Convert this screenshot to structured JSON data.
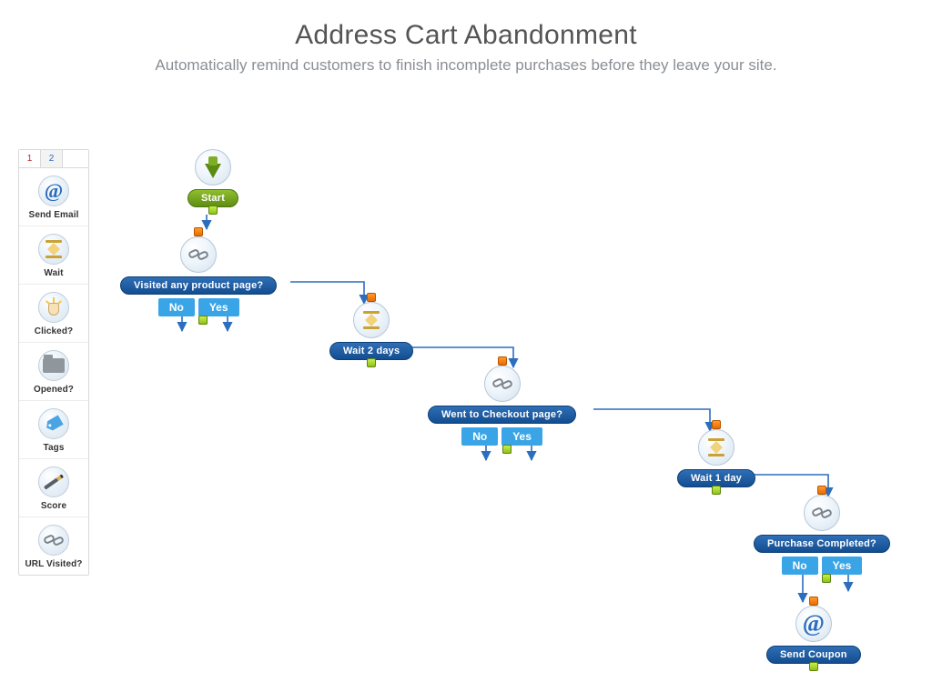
{
  "header": {
    "title": "Address Cart Abandonment",
    "subtitle": "Automatically remind customers to finish incomplete purchases before they leave your site."
  },
  "palette": {
    "tabs": [
      "1",
      "2"
    ],
    "active_tab_index": 0,
    "items": [
      {
        "id": "send-email",
        "label": "Send Email",
        "icon": "at"
      },
      {
        "id": "wait",
        "label": "Wait",
        "icon": "hourglass"
      },
      {
        "id": "clicked",
        "label": "Clicked?",
        "icon": "click"
      },
      {
        "id": "opened",
        "label": "Opened?",
        "icon": "folder"
      },
      {
        "id": "tags",
        "label": "Tags",
        "icon": "tag"
      },
      {
        "id": "score",
        "label": "Score",
        "icon": "pencil"
      },
      {
        "id": "url-visited",
        "label": "URL Visited?",
        "icon": "chain"
      }
    ]
  },
  "flow": {
    "start_label": "Start",
    "yes_label": "Yes",
    "no_label": "No",
    "nodes": {
      "visited_product": {
        "label": "Visited any product page?"
      },
      "wait_2_days": {
        "label": "Wait 2 days"
      },
      "went_checkout": {
        "label": "Went to Checkout page?"
      },
      "wait_1_day": {
        "label": "Wait 1 day"
      },
      "purchase_done": {
        "label": "Purchase Completed?"
      },
      "send_coupon": {
        "label": "Send Coupon"
      }
    }
  },
  "colors": {
    "pill_blue_top": "#2f6fb6",
    "pill_blue_bot": "#134d90",
    "accent_blue": "#3aa5e6",
    "green": "#7eae25",
    "orange": "#e86d00"
  }
}
